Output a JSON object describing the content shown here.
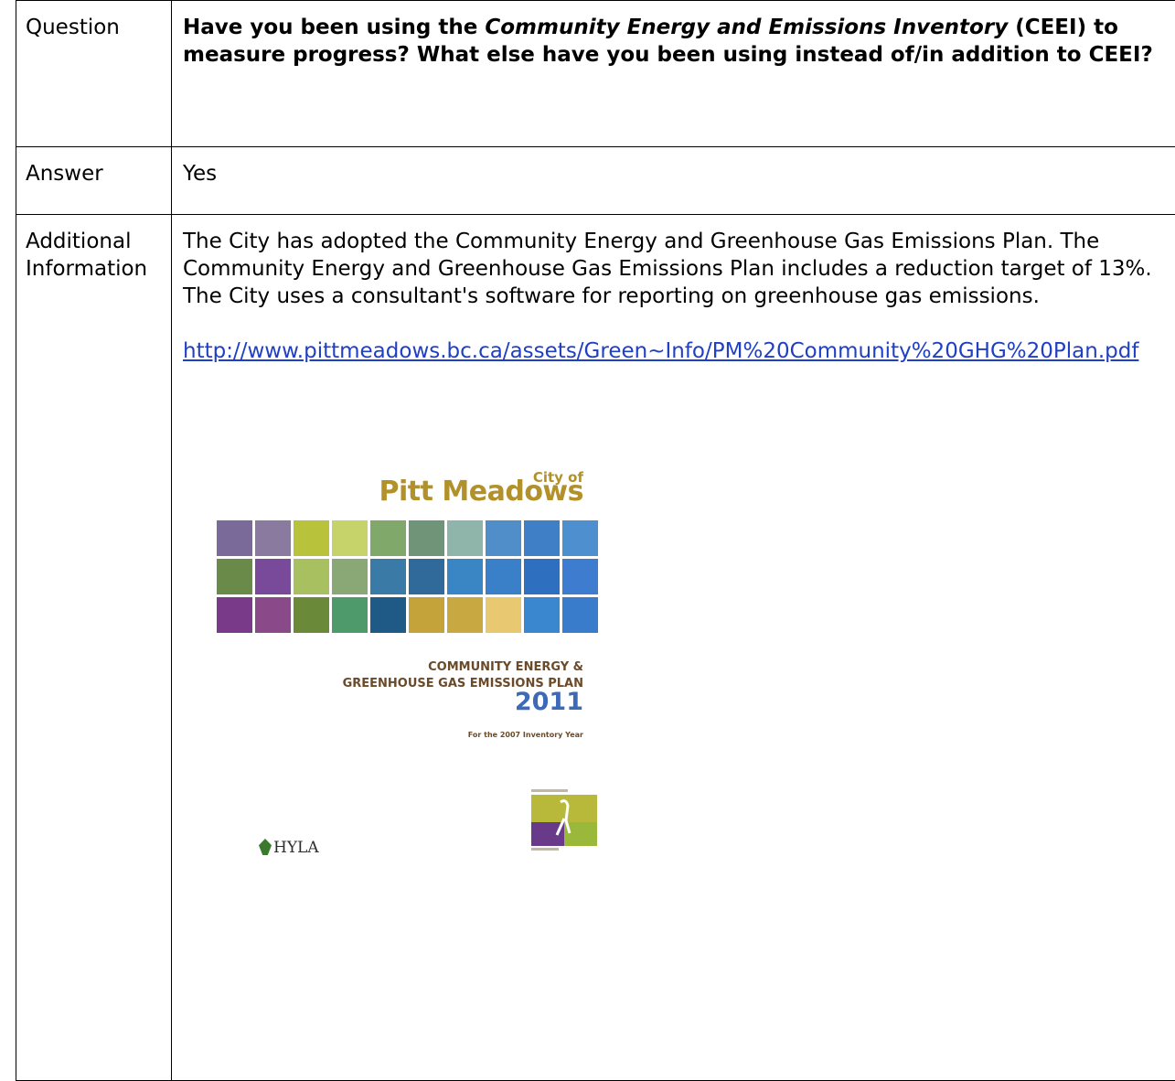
{
  "rows": {
    "question": {
      "label": "Question",
      "text_part1": "Have you been using the ",
      "text_italic": "Community Energy and Emissions Inventory",
      "text_part2": " (CEEI) to measure progress? What else have you been using instead of/in addition to CEEI?"
    },
    "answer": {
      "label": "Answer",
      "value": "Yes"
    },
    "additional": {
      "label": "Additional Information",
      "text": "The City has adopted the Community Energy and Greenhouse Gas Emissions Plan. The Community Energy and Greenhouse Gas Emissions Plan includes a reduction target of 13%.  The City uses a consultant's software for reporting on greenhouse gas emissions.",
      "link": "http://www.pittmeadows.bc.ca/assets/Green~Info/PM%20Community%20GHG%20Plan.pdf"
    }
  },
  "cover": {
    "city_of": "City of",
    "city_name": "Pitt Meadows",
    "plan_title_line1": "COMMUNITY ENERGY &",
    "plan_title_line2": "GREENHOUSE GAS EMISSIONS PLAN",
    "plan_year": "2011",
    "plan_subtitle": "For the 2007 Inventory Year",
    "hyla_logo_text": "HYLA",
    "tile_colors": [
      "#7a6a9a",
      "#8a7aa0",
      "#b8c23a",
      "#c6d36a",
      "#7fa86a",
      "#6f9478",
      "#8fb4aa",
      "#4f8ec8",
      "#3f7fc6",
      "#4e8fd0",
      "#6a8a4a",
      "#7a4a9a",
      "#a8c060",
      "#8aa876",
      "#3a7aa6",
      "#2f6a9a",
      "#3a86c4",
      "#3a80c8",
      "#2f6fc0",
      "#3d7ccf",
      "#7a3a8a",
      "#8a4a8a",
      "#6a8a3a",
      "#4f9a6a",
      "#1f5a86",
      "#c4a43a",
      "#c8a840",
      "#e8c870",
      "#3a86cf",
      "#3a7ccc"
    ]
  }
}
